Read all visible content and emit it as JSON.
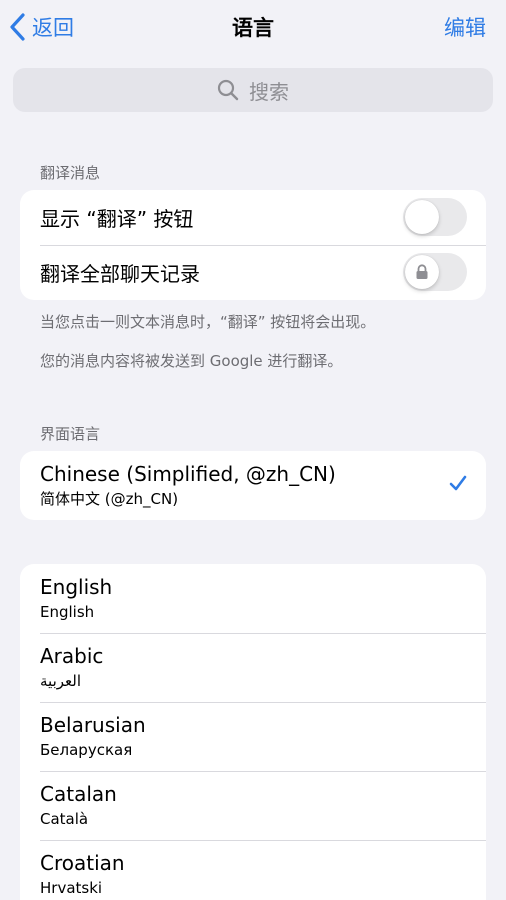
{
  "nav": {
    "back_label": "返回",
    "title": "语言",
    "edit_label": "编辑"
  },
  "search": {
    "placeholder": "搜索"
  },
  "translate_section": {
    "header": "翻译消息",
    "show_translate_button": {
      "label": "显示 “翻译” 按钮",
      "on": false
    },
    "translate_all_chats": {
      "label": "翻译全部聊天记录",
      "on": false,
      "locked": true
    },
    "footnote_1": "当您点击一则文本消息时，“翻译” 按钮将会出现。",
    "footnote_2": "您的消息内容将被发送到 Google 进行翻译。"
  },
  "interface_section": {
    "header": "界面语言",
    "selected": {
      "name": "Chinese (Simplified, @zh_CN)",
      "native": "简体中文 (@zh_CN)",
      "checked": true
    }
  },
  "languages": [
    {
      "name": "English",
      "native": "English"
    },
    {
      "name": "Arabic",
      "native": "العربية"
    },
    {
      "name": "Belarusian",
      "native": "Беларуская"
    },
    {
      "name": "Catalan",
      "native": "Català"
    },
    {
      "name": "Croatian",
      "native": "Hrvatski"
    }
  ],
  "colors": {
    "accent": "#2f7ce5",
    "background": "#f2f2f7",
    "toggle_off": "#e9e9eb"
  }
}
